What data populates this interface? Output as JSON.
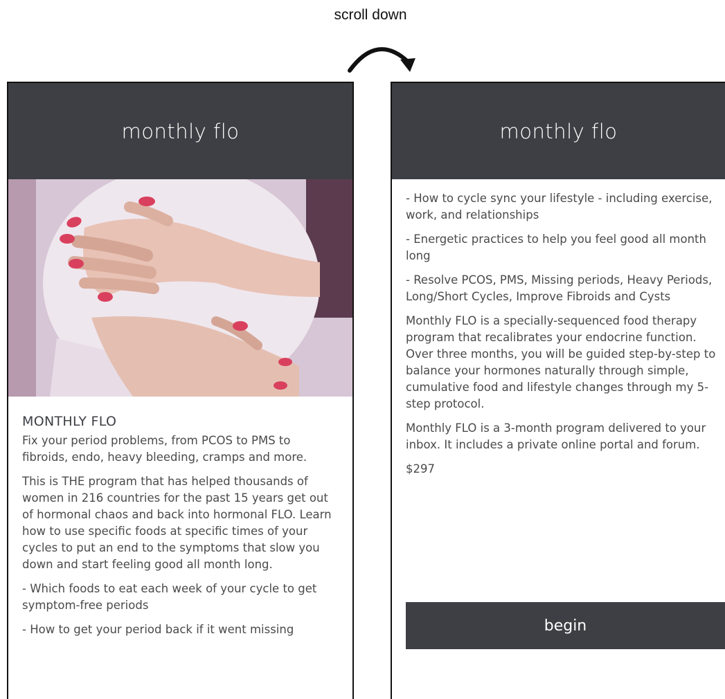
{
  "annotation": {
    "caption": "scroll down"
  },
  "app": {
    "title": "monthly flo"
  },
  "screen_left": {
    "heading": "MONTHLY FLO",
    "paragraphs": [
      "Fix your period problems, from PCOS to PMS to fibroids, endo, heavy bleeding, cramps and more.",
      "This is THE program that has helped thousands of women in 216 countries for the past 15 years get out of hormonal chaos and back into hormonal FLO. Learn how to use specific foods at specific times of your cycles to put an end to the symptoms that slow you down and start feeling good all month long.",
      "- Which foods to eat each week of your cycle to get symptom-free periods",
      "- How to get your period back if it went missing"
    ]
  },
  "screen_right": {
    "paragraphs": [
      "- How to cycle sync your lifestyle - including exercise, work, and relationships",
      "- Energetic practices to help you feel good all month long",
      "- Resolve PCOS, PMS, Missing periods, Heavy Periods, Long/Short Cycles, Improve Fibroids and Cysts",
      "Monthly FLO is a specially-sequenced food therapy program that recalibrates your endocrine function. Over three months, you will be guided step-by-step to balance your hormones naturally through simple, cumulative food and lifestyle changes through my 5-step protocol.",
      "Monthly FLO is a 3-month program delivered to your inbox. It includes a private online portal and forum.",
      "$297"
    ],
    "button_label": "begin"
  },
  "colors": {
    "header_bg": "#3d3f44",
    "header_text": "#ffffff",
    "body_text": "#4a4a4a",
    "hero_bg": "#d7c6d6",
    "nail_polish": "#d9405e"
  },
  "icons": {
    "scroll": "curved-arrow-icon"
  }
}
